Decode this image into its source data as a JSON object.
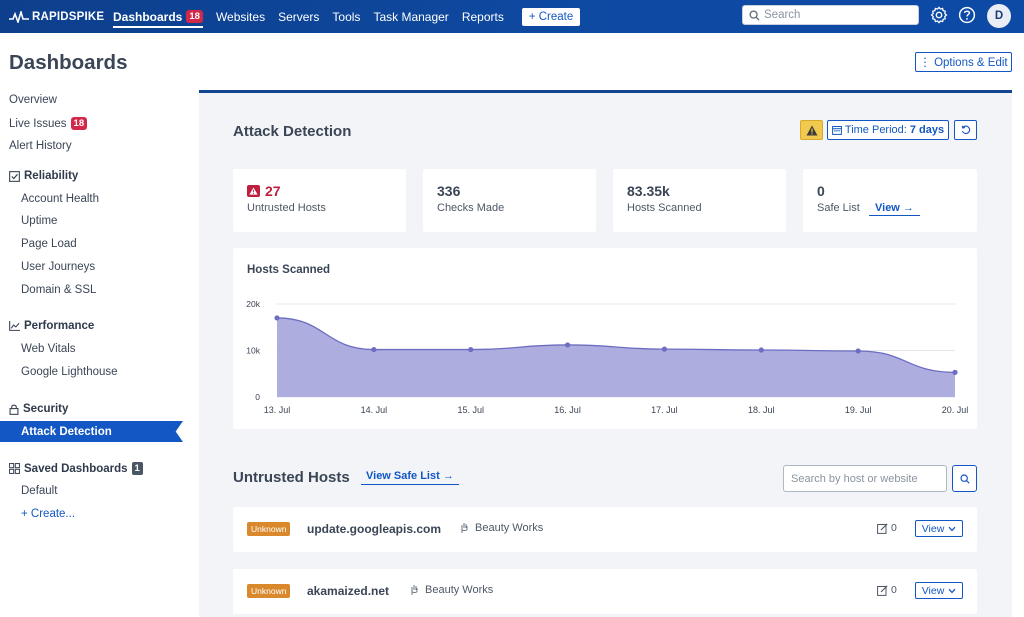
{
  "brand": {
    "name": "RAPIDSPIKE"
  },
  "nav": {
    "items": [
      {
        "label": "Dashboards",
        "badge": "18",
        "active": true
      },
      {
        "label": "Websites"
      },
      {
        "label": "Servers"
      },
      {
        "label": "Tools"
      },
      {
        "label": "Task Manager"
      },
      {
        "label": "Reports"
      }
    ],
    "create_label": "+ Create",
    "search_placeholder": "Search",
    "avatar_initial": "D"
  },
  "page": {
    "title": "Dashboards",
    "options_label": "⋮ Options & Edit"
  },
  "sidebar": {
    "overview": "Overview",
    "live_issues": "Live Issues",
    "live_issues_badge": "18",
    "alert_history": "Alert History",
    "reliability": "Reliability",
    "account_health": "Account Health",
    "uptime": "Uptime",
    "page_load": "Page Load",
    "user_journeys": "User Journeys",
    "domain_ssl": "Domain & SSL",
    "performance": "Performance",
    "web_vitals": "Web Vitals",
    "google_lighthouse": "Google Lighthouse",
    "security": "Security",
    "attack_detection": "Attack Detection",
    "saved_dashboards": "Saved Dashboards",
    "saved_badge": "1",
    "default": "Default",
    "create": "+ Create..."
  },
  "attack": {
    "title": "Attack Detection",
    "time_period_label": "Time Period:",
    "time_period_value": "7 days"
  },
  "stats": {
    "untrusted": {
      "value": "27",
      "label": "Untrusted Hosts"
    },
    "checks": {
      "value": "336",
      "label": "Checks Made"
    },
    "scanned": {
      "value": "83.35k",
      "label": "Hosts Scanned"
    },
    "safe": {
      "value": "0",
      "label": "Safe List",
      "link": "View →"
    }
  },
  "chart_data": {
    "type": "area",
    "title": "Hosts Scanned",
    "categories": [
      "13. Jul",
      "14. Jul",
      "15. Jul",
      "16. Jul",
      "17. Jul",
      "18. Jul",
      "19. Jul",
      "20. Jul"
    ],
    "values": [
      17000,
      10200,
      10200,
      11200,
      10300,
      10100,
      9900,
      5300
    ],
    "ylim": [
      0,
      20000
    ],
    "yticks": [
      "0",
      "10k",
      "20k"
    ],
    "color": "#a9a9de",
    "line_color": "#6d6dc2"
  },
  "untrusted_hosts": {
    "title": "Untrusted Hosts",
    "view_safe_list": "View Safe List →",
    "search_placeholder": "Search by host or website",
    "rows": [
      {
        "status": "Unknown",
        "host": "update.googleapis.com",
        "account": "Beauty Works",
        "notes": "0",
        "action": "View"
      },
      {
        "status": "Unknown",
        "host": "akamaized.net",
        "account": "Beauty Works",
        "notes": "0",
        "action": "View"
      }
    ]
  },
  "colors": {
    "brand": "#0e4aa3",
    "accent": "#1357c4",
    "danger": "#c0203f",
    "warning": "#f1c94f",
    "unknown": "#d9892c"
  }
}
